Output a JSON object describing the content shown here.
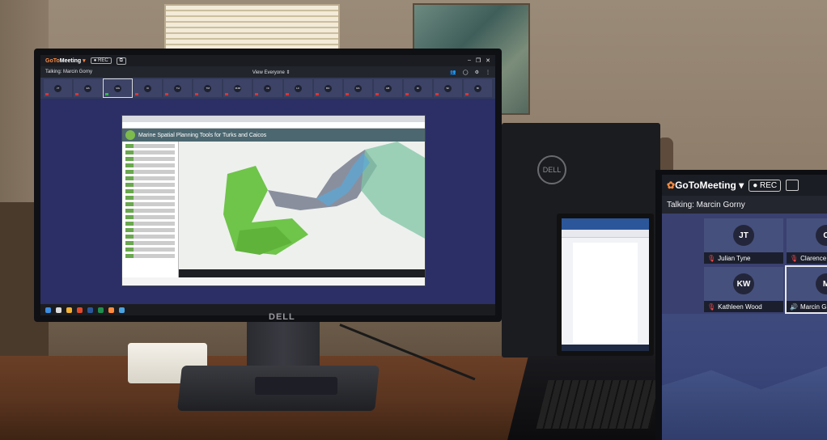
{
  "gotomeeting": {
    "brand_goto": "GoTo",
    "brand_meeting": "Meeting",
    "rec_label": "REC",
    "talking": "Talking: Marcin Gorny",
    "view_label": "View Everyone",
    "participants_small": [
      "JT",
      "ES",
      "MG",
      "KI",
      "TH",
      "TM",
      "MJM",
      "NI",
      "LC",
      "MV",
      "GS",
      "HB",
      "ID",
      "SF",
      "BI"
    ],
    "tiles": [
      {
        "initials": "JT",
        "name": "Julian Tyne",
        "muted": true
      },
      {
        "initials": "C",
        "name": "Clarence S",
        "muted": true
      },
      {
        "initials": "KW",
        "name": "Kathleen Wood",
        "muted": true
      },
      {
        "initials": "M",
        "name": "Marcin G",
        "muted": false
      }
    ]
  },
  "shared_screen": {
    "app_title": "Marine Spatial Planning Tools for Turks and Caicos"
  },
  "hardware": {
    "monitor_brand": "DELL",
    "back_monitor_brand": "DELL"
  },
  "colors": {
    "gtm_orange": "#ff8a3d",
    "meeting_bg": "#2b2f66",
    "muted_red": "#ff4b4b",
    "active_green": "#34c759",
    "map_green": "#6fc44a"
  }
}
